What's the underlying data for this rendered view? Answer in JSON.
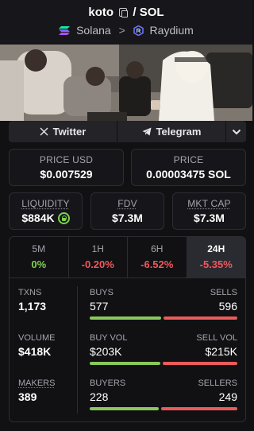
{
  "header": {
    "token": "koto",
    "separator": "/",
    "quote": "SOL",
    "chain": "Solana",
    "dex": "Raydium",
    "chain_chevron": ">"
  },
  "social": {
    "twitter": "Twitter",
    "telegram": "Telegram"
  },
  "price": {
    "usd_label": "PRICE USD",
    "usd_value": "$0.007529",
    "native_label": "PRICE",
    "native_value": "0.00003475 SOL"
  },
  "metrics": {
    "liquidity_label": "LIQUIDITY",
    "liquidity_value": "$884K",
    "fdv_label": "FDV",
    "fdv_value": "$7.3M",
    "mktcap_label": "MKT CAP",
    "mktcap_value": "$7.3M"
  },
  "tabs": [
    {
      "label": "5M",
      "value": "0%"
    },
    {
      "label": "1H",
      "value": "-0.20%"
    },
    {
      "label": "6H",
      "value": "-6.52%"
    },
    {
      "label": "24H",
      "value": "-5.35%"
    }
  ],
  "active_tab": "24H",
  "stats": {
    "txns_label": "TXNS",
    "txns_value": "1,173",
    "volume_label": "VOLUME",
    "volume_value": "$418K",
    "makers_label": "MAKERS",
    "makers_value": "389",
    "buys_label": "BUYS",
    "buys_value": "577",
    "sells_label": "SELLS",
    "sells_value": "596",
    "buys_fraction": 0.492,
    "buyvol_label": "BUY VOL",
    "buyvol_value": "$203K",
    "sellvol_label": "SELL VOL",
    "sellvol_value": "$215K",
    "buyvol_fraction": 0.486,
    "buyers_label": "BUYERS",
    "buyers_value": "228",
    "sellers_label": "SELLERS",
    "sellers_value": "249",
    "buyers_fraction": 0.478
  },
  "colors": {
    "positive": "#7fd34e",
    "negative": "#f0585a",
    "buy_bar": "#8ac85a",
    "sell_bar": "#ec5a5a"
  },
  "icons": {
    "copy": "copy-icon",
    "solana": "solana-icon",
    "raydium": "raydium-icon",
    "x": "x-icon",
    "telegram": "telegram-icon",
    "chevron": "chevron-down-icon",
    "lock": "lock-icon"
  }
}
